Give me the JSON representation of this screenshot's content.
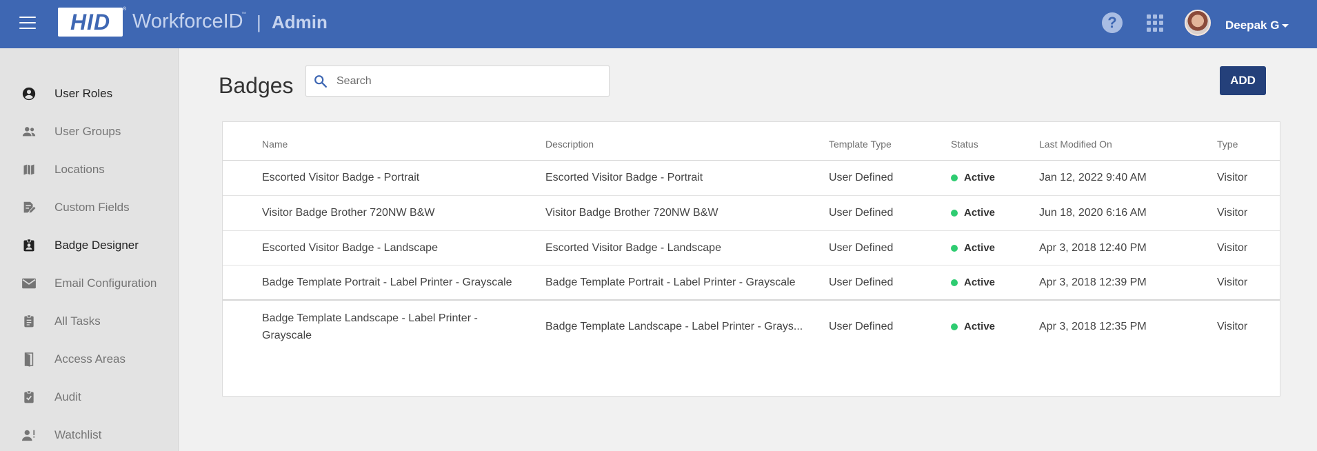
{
  "header": {
    "logo_text": "HID",
    "logo_reg": "®",
    "product": "WorkforceID",
    "product_tm": "™",
    "separator": "|",
    "section": "Admin",
    "user_name": "Deepak G",
    "help_glyph": "?",
    "icons": [
      "menu-icon",
      "help-icon",
      "apps-grid-icon",
      "avatar",
      "caret-down-icon"
    ],
    "brand_color": "#3e67b3"
  },
  "sidebar": {
    "items": [
      {
        "label": "User Roles",
        "icon": "account-circle-icon",
        "active": true
      },
      {
        "label": "User Groups",
        "icon": "people-icon",
        "active": false
      },
      {
        "label": "Locations",
        "icon": "map-icon",
        "active": false
      },
      {
        "label": "Custom Fields",
        "icon": "edit-document-icon",
        "active": false
      },
      {
        "label": "Badge Designer",
        "icon": "badge-icon",
        "active": true
      },
      {
        "label": "Email Configuration",
        "icon": "mail-icon",
        "active": false
      },
      {
        "label": "All Tasks",
        "icon": "clipboard-list-icon",
        "active": false
      },
      {
        "label": "Access Areas",
        "icon": "door-icon",
        "active": false
      },
      {
        "label": "Audit",
        "icon": "clipboard-check-icon",
        "active": false
      },
      {
        "label": "Watchlist",
        "icon": "person-alert-icon",
        "active": false
      }
    ]
  },
  "main": {
    "title": "Badges",
    "search_placeholder": "Search",
    "add_label": "ADD",
    "add_color": "#24407a",
    "table": {
      "columns": [
        "Name",
        "Description",
        "Template Type",
        "Status",
        "Last Modified On",
        "Type"
      ],
      "rows": [
        {
          "name": "Escorted Visitor Badge - Portrait",
          "name2": "",
          "description": "Escorted Visitor Badge - Portrait",
          "template_type": "User Defined",
          "status": "Active",
          "modified": "Jan 12, 2022 9:40 AM",
          "type": "Visitor"
        },
        {
          "name": "Visitor Badge Brother 720NW B&W",
          "name2": "",
          "description": "Visitor Badge Brother 720NW B&W",
          "template_type": "User Defined",
          "status": "Active",
          "modified": "Jun 18, 2020 6:16 AM",
          "type": "Visitor"
        },
        {
          "name": "Escorted Visitor Badge - Landscape",
          "name2": "",
          "description": "Escorted Visitor Badge - Landscape",
          "template_type": "User Defined",
          "status": "Active",
          "modified": "Apr 3, 2018 12:40 PM",
          "type": "Visitor"
        },
        {
          "name": "Badge Template Portrait - Label Printer - Grayscale",
          "name2": "",
          "description": "Badge Template Portrait - Label Printer - Grayscale",
          "template_type": "User Defined",
          "status": "Active",
          "modified": "Apr 3, 2018 12:39 PM",
          "type": "Visitor"
        },
        {
          "name": "Badge Template Landscape - Label Printer -",
          "name2": "Grayscale",
          "description": "Badge Template Landscape - Label Printer - Grays...",
          "template_type": "User Defined",
          "status": "Active",
          "modified": "Apr 3, 2018 12:35 PM",
          "type": "Visitor"
        }
      ],
      "status_color": "#2ecc71"
    }
  }
}
